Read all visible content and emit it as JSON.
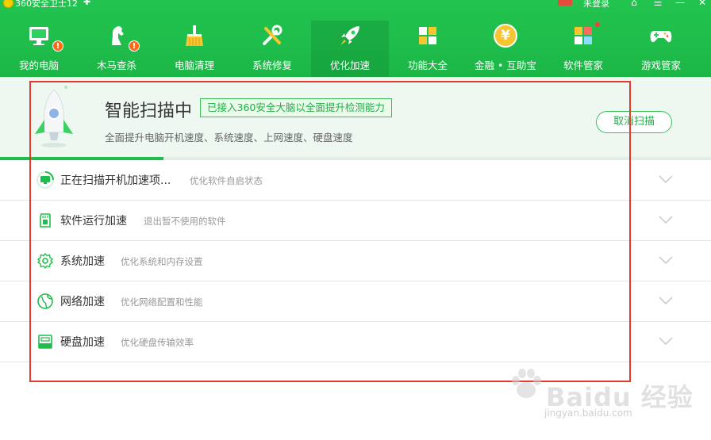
{
  "app": {
    "title": "360安全卫士12",
    "login": "未登录",
    "window_controls": [
      "⌂",
      "☰",
      "—",
      "✕"
    ]
  },
  "nav": {
    "items": [
      {
        "label": "我的电脑",
        "icon": "computer-icon",
        "badge": "!"
      },
      {
        "label": "木马查杀",
        "icon": "horse-icon",
        "badge": "!"
      },
      {
        "label": "电脑清理",
        "icon": "broom-icon"
      },
      {
        "label": "系统修复",
        "icon": "tools-icon"
      },
      {
        "label": "优化加速",
        "icon": "rocket-icon",
        "active": true
      },
      {
        "label": "功能大全",
        "icon": "grid-icon"
      },
      {
        "label": "金融 • 互助宝",
        "icon": "coin-icon",
        "coin_symbol": "¥"
      },
      {
        "label": "软件管家",
        "icon": "software-icon"
      },
      {
        "label": "游戏管家",
        "icon": "gamepad-icon"
      }
    ]
  },
  "scan": {
    "title": "智能扫描中",
    "brain_badge": "已接入360安全大脑以全面提升检测能力",
    "description": "全面提升电脑开机速度、系统速度、上网速度、硬盘速度",
    "cancel_label": "取消扫描",
    "progress": 0.23
  },
  "items": [
    {
      "title": "正在扫描开机加速项...",
      "subtitle": "优化软件自启状态",
      "icon": "scanning-monitor-icon"
    },
    {
      "title": "软件运行加速",
      "subtitle": "退出暂不使用的软件",
      "icon": "sd-card-icon"
    },
    {
      "title": "系统加速",
      "subtitle": "优化系统和内存设置",
      "icon": "gear-icon"
    },
    {
      "title": "网络加速",
      "subtitle": "优化网络配置和性能",
      "icon": "globe-icon"
    },
    {
      "title": "硬盘加速",
      "subtitle": "优化硬盘传输效率",
      "icon": "hard-disk-icon"
    }
  ],
  "watermark": {
    "text": "Baidu 经验",
    "url": "jingyan.baidu.com"
  },
  "colors": {
    "brand_green": "#1fbd4b",
    "annotation_red": "#e53a2f"
  }
}
